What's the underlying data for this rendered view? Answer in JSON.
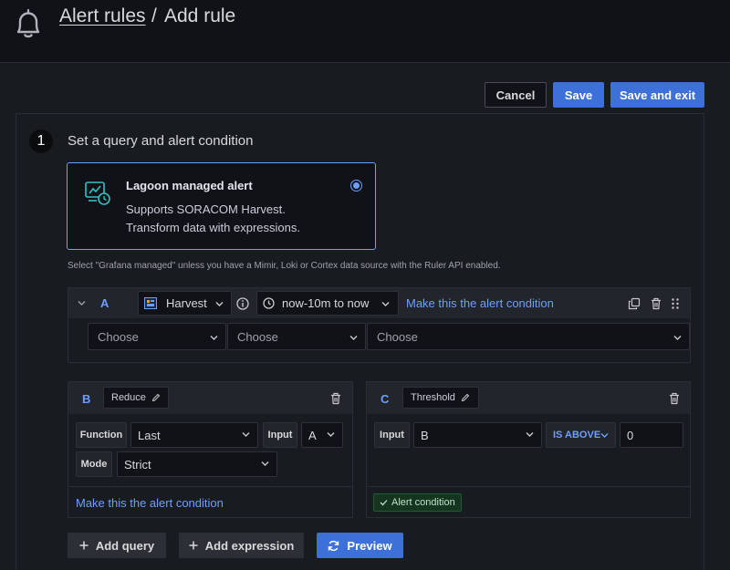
{
  "header": {
    "breadcrumb_link": "Alert rules",
    "breadcrumb_sep": "/",
    "breadcrumb_current": "Add rule"
  },
  "toolbar": {
    "cancel_label": "Cancel",
    "save_label": "Save",
    "save_exit_label": "Save and exit"
  },
  "step": {
    "number": "1",
    "title": "Set a query and alert condition"
  },
  "rule_type_card": {
    "title": "Lagoon managed alert",
    "desc_line1": "Supports SORACOM Harvest.",
    "desc_line2": "Transform data with expressions.",
    "selected": true
  },
  "hint": "Select \"Grafana managed\" unless you have a Mimir, Loki or Cortex data source with the Ruler API enabled.",
  "query_a": {
    "ref": "A",
    "datasource": "Harvest",
    "time_range": "now-10m to now",
    "make_condition_label": "Make this the alert condition",
    "selects": [
      "Choose",
      "Choose",
      "Choose"
    ]
  },
  "expression_b": {
    "ref": "B",
    "type": "Reduce",
    "function_label": "Function",
    "function_value": "Last",
    "input_label": "Input",
    "input_value": "A",
    "mode_label": "Mode",
    "mode_value": "Strict",
    "make_condition_label": "Make this the alert condition"
  },
  "expression_c": {
    "ref": "C",
    "type": "Threshold",
    "input_label": "Input",
    "input_value": "B",
    "operator": "IS ABOVE",
    "threshold_value": "0",
    "alert_condition_badge": "Alert condition"
  },
  "actions": {
    "add_query": "Add query",
    "add_expression": "Add expression",
    "preview": "Preview"
  },
  "colors": {
    "accent": "#3d71d9",
    "link": "#6e9fff",
    "success": "#1e5c34"
  }
}
